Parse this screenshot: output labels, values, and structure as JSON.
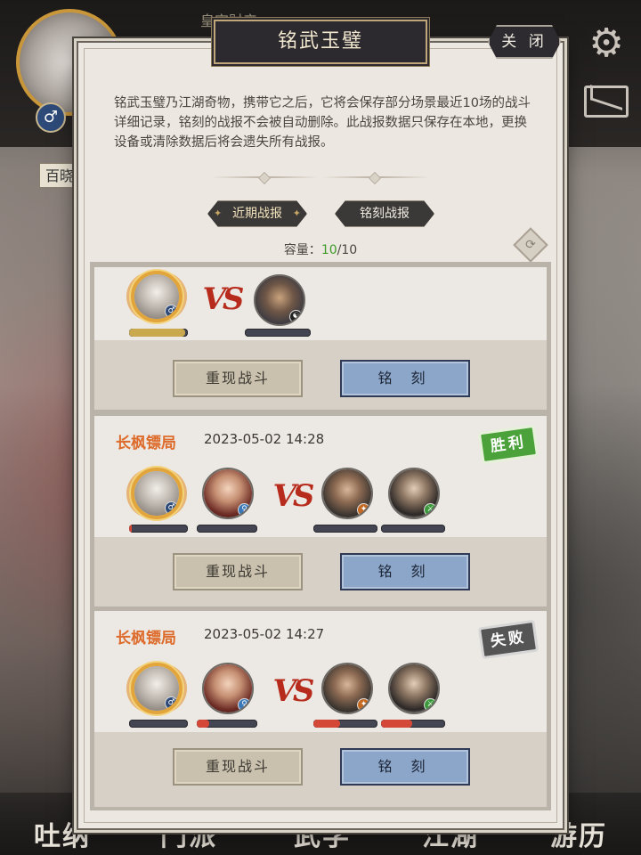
{
  "background": {
    "top_title": "皇宫财产",
    "player_name": "百晓",
    "gender_symbol": "♂",
    "bottom_nav": [
      "吐纳",
      "门派",
      "武学",
      "江湖",
      "游历"
    ]
  },
  "modal": {
    "title": "铭武玉璧",
    "close_label": "关 闭",
    "description": "铭武玉璧乃江湖奇物，携带它之后，它将会保存部分场景最近10场的战斗详细记录，铭刻的战报不会被自动删除。此战报数据只保存在本地，更换设备或清除数据后将会遗失所有战报。",
    "tabs": [
      {
        "label": "近期战报",
        "active": true
      },
      {
        "label": "铭刻战报",
        "active": false
      }
    ],
    "capacity": {
      "label": "容量：",
      "used": "10",
      "total": "/10"
    },
    "refresh_icon": "refresh-icon"
  },
  "battles": [
    {
      "team": "",
      "time": "",
      "result": "",
      "vs_text": "VS",
      "left_hp": [
        0.95
      ],
      "right_hp": [
        0
      ],
      "replay_label": "重现战斗",
      "engrave_label": "铭 刻"
    },
    {
      "team": "长枫镖局",
      "time": "2023-05-02 14:28",
      "result": "胜利",
      "vs_text": "VS",
      "left_hp": [
        0.05,
        0
      ],
      "right_hp": [
        0,
        0
      ],
      "replay_label": "重现战斗",
      "engrave_label": "铭 刻"
    },
    {
      "team": "长枫镖局",
      "time": "2023-05-02 14:27",
      "result": "失败",
      "vs_text": "VS",
      "left_hp": [
        0,
        0.2
      ],
      "right_hp": [
        0.42,
        0.48
      ],
      "replay_label": "重现战斗",
      "engrave_label": "铭 刻"
    }
  ],
  "colors": {
    "team_name": "#dd6b2b",
    "win": "#4ba23a",
    "lose": "#555555",
    "hp_fill_full": "#c9a84e",
    "hp_fill": "#d44838",
    "capacity_used": "#3f9a2a"
  }
}
